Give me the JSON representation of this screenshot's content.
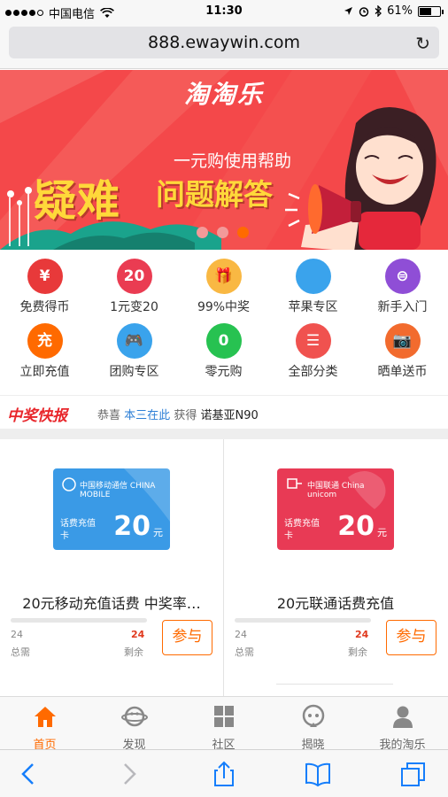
{
  "status_bar": {
    "carrier": "中国电信",
    "time": "11:30",
    "battery_percent": "61%",
    "battery_level": 0.61
  },
  "browser": {
    "url": "888.ewaywin.com",
    "reload_icon": "reload-icon"
  },
  "banner": {
    "logo": "淘淘乐",
    "subtitle": "一元购使用帮助",
    "headline_big": "疑难",
    "headline_rest": "问题解答",
    "slides": 3,
    "active_slide": 3,
    "background_color": "#f4484a"
  },
  "grid": {
    "items": [
      {
        "label": "免费得币",
        "glyph": "¥",
        "color": "#e8393a",
        "icon": "yen-icon"
      },
      {
        "label": "1元变20",
        "glyph": "20",
        "color": "#ea3c52",
        "icon": "twenty-icon"
      },
      {
        "label": "99%中奖",
        "glyph": "🎁",
        "color": "#f9b843",
        "icon": "gift-icon"
      },
      {
        "label": "苹果专区",
        "glyph": "",
        "color": "#3aa3ec",
        "icon": "apple-icon"
      },
      {
        "label": "新手入门",
        "glyph": "⊜",
        "color": "#8f4ed6",
        "icon": "newbie-icon"
      },
      {
        "label": "立即充值",
        "glyph": "充",
        "color": "#ff6a00",
        "icon": "recharge-icon"
      },
      {
        "label": "团购专区",
        "glyph": "🎮",
        "color": "#3aa3ec",
        "icon": "gamepad-icon"
      },
      {
        "label": "零元购",
        "glyph": "0",
        "color": "#27c251",
        "icon": "zero-icon"
      },
      {
        "label": "全部分类",
        "glyph": "☰",
        "color": "#f0524f",
        "icon": "list-icon"
      },
      {
        "label": "晒单送币",
        "glyph": "📷",
        "color": "#f26b2e",
        "icon": "camera-icon"
      }
    ]
  },
  "news": {
    "tag": "中奖快报",
    "prefix": "恭喜",
    "user": "本三在此",
    "action": "获得",
    "prize": "诺基亚N90"
  },
  "products": [
    {
      "title": "20元移动充值话费 中奖率…",
      "card_brand": "中国移动通信 CHINA MOBILE",
      "card_kind": "话费充值卡",
      "card_amount": "20",
      "card_unit": "元",
      "card_color": "#3a9ae6",
      "total": "24",
      "total_label": "总需",
      "left": "24",
      "left_label": "剩余",
      "progress": 0.0,
      "button": "参与"
    },
    {
      "title": "20元联通话费充值",
      "card_brand": "中国联通 China unicom",
      "card_kind": "话费充值卡",
      "card_amount": "20",
      "card_unit": "元",
      "card_color": "#e83a55",
      "total": "24",
      "total_label": "总需",
      "left": "24",
      "left_label": "剩余",
      "progress": 0.0,
      "button": "参与"
    }
  ],
  "tabbar": {
    "active": 0,
    "accent": "#ff6a00",
    "tabs": [
      {
        "label": "首页",
        "icon": "home-icon"
      },
      {
        "label": "发现",
        "icon": "planet-icon"
      },
      {
        "label": "社区",
        "icon": "grid-icon"
      },
      {
        "label": "揭晓",
        "icon": "announce-icon"
      },
      {
        "label": "我的淘乐",
        "icon": "user-icon"
      }
    ]
  },
  "toolbar": {
    "icons": [
      "back-icon",
      "forward-icon",
      "share-icon",
      "bookmarks-icon",
      "tabs-icon"
    ]
  }
}
